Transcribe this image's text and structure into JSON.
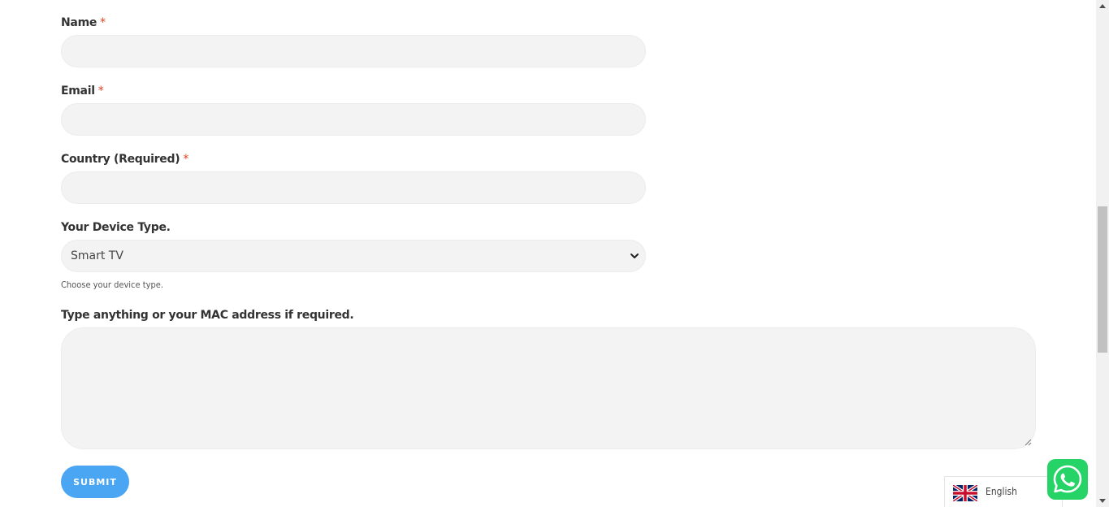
{
  "form": {
    "name": {
      "label": "Name",
      "required_mark": "*",
      "value": ""
    },
    "email": {
      "label": "Email",
      "required_mark": "*",
      "value": ""
    },
    "country": {
      "label": "Country (Required)",
      "required_mark": "*",
      "value": ""
    },
    "device_type": {
      "label": "Your Device Type.",
      "selected_value": "Smart TV",
      "help_text": "Choose your device type."
    },
    "message": {
      "label": "Type anything or your MAC address if required.",
      "value": ""
    },
    "submit_label": "SUBMIT"
  },
  "language_switcher": {
    "label": "English",
    "flag_icon": "uk-flag-icon"
  },
  "whatsapp": {
    "icon": "whatsapp-icon"
  },
  "colors": {
    "accent": "#4aa6f2",
    "required": "#e2401c",
    "whatsapp": "#25d366",
    "field_bg": "#f3f3f3"
  }
}
